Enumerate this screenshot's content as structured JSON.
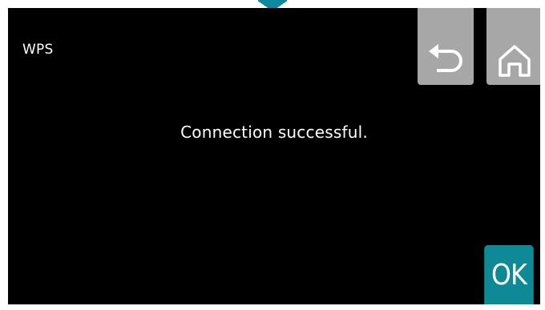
{
  "header": {
    "title": "WPS",
    "back_icon": "undo-arrow-icon",
    "home_icon": "home-icon"
  },
  "main": {
    "message": "Connection successful."
  },
  "actions": {
    "ok_label": "OK"
  },
  "colors": {
    "screen_bg": "#000000",
    "nav_button_bg": "#a7a7a7",
    "ok_button_bg": "#0e8a97",
    "indicator": "#0e87a0",
    "text": "#ffffff"
  }
}
